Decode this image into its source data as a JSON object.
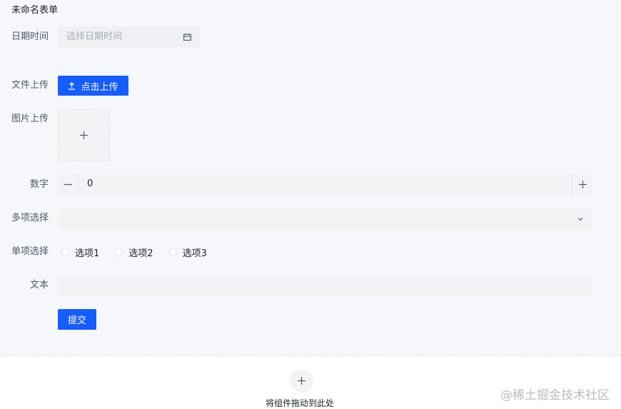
{
  "form": {
    "title": "未命名表单",
    "date_label": "日期时间",
    "date_placeholder": "选择日期时间",
    "file_label": "文件上传",
    "file_button": "点击上传",
    "image_label": "图片上传",
    "number_label": "数字",
    "number_value": "0",
    "multi_label": "多项选择",
    "radio_label": "单项选择",
    "radio_options": [
      "选项1",
      "选项2",
      "选项3"
    ],
    "text_label": "文本",
    "submit_label": "提交"
  },
  "dropzone": {
    "hint": "将组件拖动到此处"
  },
  "watermark": "@稀土掘金技术社区",
  "colors": {
    "primary": "#165dff",
    "form_bg": "#f5f7fa",
    "field_bg": "#f2f3f5"
  },
  "icons": [
    "calendar-icon",
    "upload-icon",
    "plus-icon",
    "minus-icon",
    "chevron-down-icon"
  ]
}
